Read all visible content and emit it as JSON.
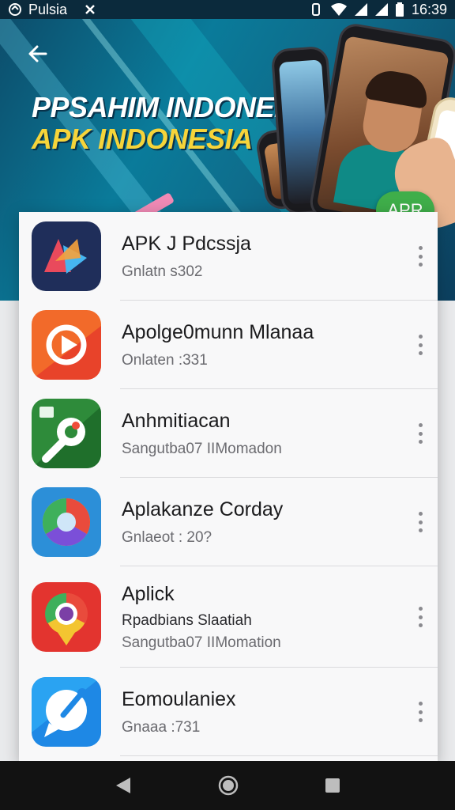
{
  "status_bar": {
    "carrier": "Pulsia",
    "time": "16:39",
    "icons": [
      "sync-icon",
      "network-icon",
      "vibrate-icon",
      "wifi-icon",
      "signal-icon",
      "signal-icon",
      "battery-icon"
    ]
  },
  "banner": {
    "title_line1": "PPSAHIM INDONEHIA",
    "title_line2": "APK INDONESIA",
    "badge": "APR",
    "accent_colors": {
      "title_yellow": "#f6d43a",
      "badge_green": "#3fae4a"
    }
  },
  "apps": [
    {
      "name": "APK J Pdcssja",
      "subtitle": "Gnlatn s302",
      "subtitle2": "",
      "icon": "apk-logo-icon"
    },
    {
      "name": "Apolge0munn Mlanaa",
      "subtitle": "Onlaten :331",
      "subtitle2": "",
      "icon": "play-icon"
    },
    {
      "name": "Anhmitiacan",
      "subtitle": "Sangutba07 IIMomadon",
      "subtitle2": "",
      "icon": "tool-icon"
    },
    {
      "name": "Aplakanze Corday",
      "subtitle": "Gnlaeot : 20?",
      "subtitle2": "",
      "icon": "chrome-like-icon"
    },
    {
      "name": "Aplick",
      "subtitle": "Rpadbians Slaatiah",
      "subtitle2": "Sangutba07 IIMomation",
      "icon": "chrome-pin-icon"
    },
    {
      "name": "Eomoulaniex",
      "subtitle": "Gnaaa :731",
      "subtitle2": "",
      "icon": "chat-bubble-icon"
    }
  ],
  "nav": {
    "icons": [
      "back-triangle-icon",
      "home-circle-icon",
      "recents-square-icon"
    ]
  }
}
